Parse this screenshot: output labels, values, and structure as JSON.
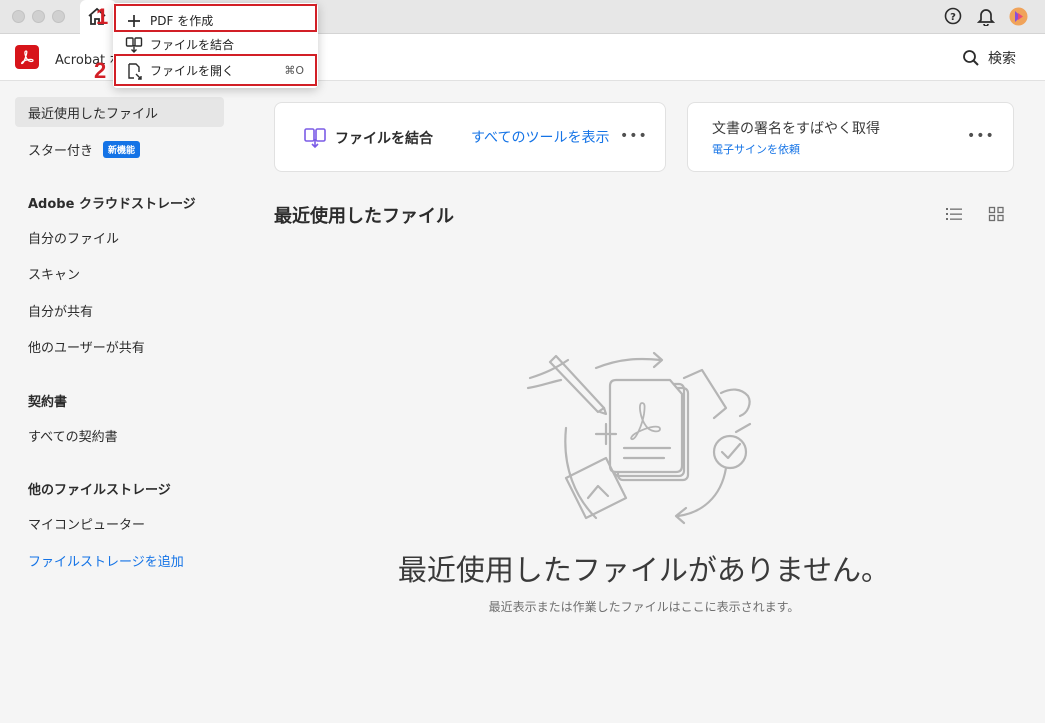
{
  "titlebar": {
    "icons": [
      "help-icon",
      "bell-icon",
      "avatar"
    ]
  },
  "header": {
    "app_title": "Acrobat ホーム",
    "search_label": "検索"
  },
  "menu": {
    "items": [
      {
        "label": "PDF を作成",
        "icon": "plus-icon",
        "shortcut": ""
      },
      {
        "label": "ファイルを結合",
        "icon": "combine-icon",
        "shortcut": ""
      },
      {
        "label": "ファイルを開く",
        "icon": "open-file-icon",
        "shortcut": "⌘O"
      }
    ],
    "callouts": [
      "1",
      "2"
    ]
  },
  "sidebar": {
    "recent": "最近使用したファイル",
    "starred": "スター付き",
    "new_badge": "新機能",
    "cloud_heading": "Adobe クラウドストレージ",
    "cloud_items": [
      "自分のファイル",
      "スキャン",
      "自分が共有",
      "他のユーザーが共有"
    ],
    "agreements_heading": "契約書",
    "agreements_items": [
      "すべての契約書"
    ],
    "other_heading": "他のファイルストレージ",
    "other_items": [
      "マイコンピューター"
    ],
    "add_storage": "ファイルストレージを追加"
  },
  "main": {
    "tools_card": {
      "combine_label": "ファイルを結合",
      "all_tools_link": "すべてのツールを表示",
      "more": "•••"
    },
    "sign_card": {
      "title": "文書の署名をすばやく取得",
      "link": "電子サインを依頼",
      "more": "•••"
    },
    "section_title": "最近使用したファイル",
    "empty_title": "最近使用したファイルがありません。",
    "empty_subtitle": "最近表示または作業したファイルはここに表示されます。"
  },
  "colors": {
    "accent": "#1473e6",
    "brand_red": "#d7141a",
    "highlight": "#d21f26"
  }
}
